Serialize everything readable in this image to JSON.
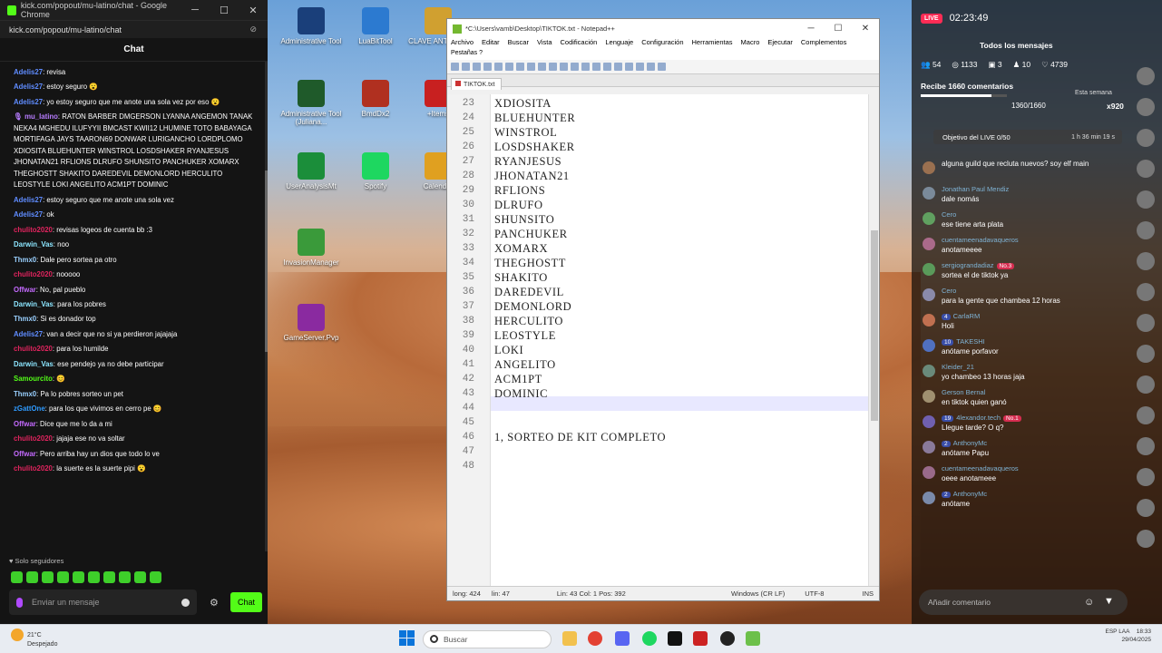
{
  "desktop": {
    "icons": [
      {
        "label": "Administrative Tool",
        "color": "#1a3f7a"
      },
      {
        "label": "LuaBitTool",
        "color": "#2c7ad0"
      },
      {
        "label": "CLAVE ANTICODI",
        "color": "#d0a030"
      },
      {
        "label": "Administrative Tool (Juliana...",
        "color": "#1f5a2a"
      },
      {
        "label": "BmdDx2",
        "color": "#b03020"
      },
      {
        "label": "+Items",
        "color": "#c82020"
      },
      {
        "label": "UserAnalysisMt",
        "color": "#1b8e3a"
      },
      {
        "label": "Spotify",
        "color": "#1ed760"
      },
      {
        "label": "Calendar",
        "color": "#e0a020"
      },
      {
        "label": "InvasionManager",
        "color": "#3a9a3a"
      },
      {
        "label": "GameServer.Pvp",
        "color": "#8a2aa0"
      }
    ]
  },
  "chat_window": {
    "title": "kick.com/popout/mu-latino/chat - Google Chrome",
    "url": "kick.com/popout/mu-latino/chat",
    "header": "Chat",
    "messages": [
      {
        "user": "",
        "text": "",
        "color": "#53fc18"
      },
      {
        "user": "Adelis27",
        "text": ": revisa",
        "color": "#5f8cff"
      },
      {
        "user": "Adelis27",
        "text": ": estoy seguro 😮",
        "color": "#5f8cff"
      },
      {
        "user": "Adelis27",
        "text": ": yo estoy seguro que me anote una sola vez por eso 😮",
        "color": "#5f8cff"
      },
      {
        "user": "🎙 mu_latino",
        "text": ": RATON BARBER DMGERSON LYANNA ANGEMON TANAK NEKA4 MGHEDU ILUFYYII BMCAST KWII12 LHUMINE TOTO BABAYAGA MORTIFAGA JAYS TAARON69 DONWAR LURIGANCHO LORDPLOMO XDIOSITA BLUEHUNTER WINSTROL LOSDSHAKER RYANJESUS JHONATAN21 RFLIONS DLRUFO SHUNSITO PANCHUKER XOMARX THEGHOSTT SHAKITO DAREDEVIL DEMONLORD HERCULITO LEOSTYLE LOKI ANGELITO ACM1PT DOMINIC",
        "color": "#b77cff"
      },
      {
        "user": "Adelis27",
        "text": ": estoy seguro que me anote una sola vez",
        "color": "#5f8cff"
      },
      {
        "user": "Adelis27",
        "text": ": ok",
        "color": "#5f8cff"
      },
      {
        "user": "chulito2020",
        "text": ": revisas logeos de cuenta bb :3",
        "color": "#e0245e"
      },
      {
        "user": "Darwin_Vas",
        "text": ": noo",
        "color": "#8ce6ff"
      },
      {
        "user": "Thmx0",
        "text": ": Dale pero sortea pa otro",
        "color": "#9ad0ff"
      },
      {
        "user": "chulito2020",
        "text": ": nooooo",
        "color": "#e0245e"
      },
      {
        "user": "Offwar",
        "text": ": No, pal pueblo",
        "color": "#c56aff"
      },
      {
        "user": "Darwin_Vas",
        "text": ": para los pobres",
        "color": "#8ce6ff"
      },
      {
        "user": "Thmx0",
        "text": ": Si es donador top",
        "color": "#9ad0ff"
      },
      {
        "user": "Adelis27",
        "text": ": van a decir que no si ya perdieron jajajaja",
        "color": "#5f8cff"
      },
      {
        "user": "chulito2020",
        "text": ": para los humilde",
        "color": "#e0245e"
      },
      {
        "user": "Darwin_Vas",
        "text": ": ese pendejo ya no debe participar",
        "color": "#8ce6ff"
      },
      {
        "user": "Samourcito",
        "text": ": 😊",
        "color": "#53fc18"
      },
      {
        "user": "Thmx0",
        "text": ": Pa lo pobres sorteo un pet",
        "color": "#9ad0ff"
      },
      {
        "user": "zGattOne",
        "text": ": para los que vivimos en cerro pe 😊",
        "color": "#2f9bff"
      },
      {
        "user": "Offwar",
        "text": ": Dice que me lo da a mi",
        "color": "#c56aff"
      },
      {
        "user": "chulito2020",
        "text": ": jajaja ese no va soltar",
        "color": "#e0245e"
      },
      {
        "user": "Offwar",
        "text": ": Pero arriba hay un dios que todo lo ve",
        "color": "#c56aff"
      },
      {
        "user": "chulito2020",
        "text": ": la suerte es la suerte pipi 😮",
        "color": "#e0245e"
      }
    ],
    "followers_only": "♥ Solo seguidores",
    "input_placeholder": "Enviar un mensaje",
    "send_label": "Chat"
  },
  "notepad": {
    "title": "*C:\\Users\\vamb\\Desktop\\TIKTOK.txt - Notepad++",
    "menu": [
      "Archivo",
      "Editar",
      "Buscar",
      "Vista",
      "Codificación",
      "Lenguaje",
      "Configuración",
      "Herramientas",
      "Macro",
      "Ejecutar",
      "Complementos"
    ],
    "menu2": "Pestañas    ?",
    "tab": "TIKTOK.txt",
    "lines": [
      {
        "n": "23",
        "t": "XDIOSITA"
      },
      {
        "n": "24",
        "t": "BLUEHUNTER"
      },
      {
        "n": "25",
        "t": "WINSTROL"
      },
      {
        "n": "26",
        "t": "LOSDSHAKER"
      },
      {
        "n": "27",
        "t": "RYANJESUS"
      },
      {
        "n": "28",
        "t": "JHONATAN21"
      },
      {
        "n": "29",
        "t": "RFLIONS"
      },
      {
        "n": "30",
        "t": "DLRUFO"
      },
      {
        "n": "31",
        "t": "SHUNSITO"
      },
      {
        "n": "32",
        "t": "PANCHUKER"
      },
      {
        "n": "33",
        "t": "XOMARX"
      },
      {
        "n": "34",
        "t": "THEGHOSTT"
      },
      {
        "n": "35",
        "t": "SHAKITO"
      },
      {
        "n": "36",
        "t": "DAREDEVIL"
      },
      {
        "n": "37",
        "t": "DEMONLORD"
      },
      {
        "n": "38",
        "t": "HERCULITO"
      },
      {
        "n": "39",
        "t": "LEOSTYLE"
      },
      {
        "n": "40",
        "t": "LOKI"
      },
      {
        "n": "41",
        "t": "ANGELITO"
      },
      {
        "n": "42",
        "t": "ACM1PT"
      },
      {
        "n": "43",
        "t": "DOMINIC"
      },
      {
        "n": "44",
        "t": ""
      },
      {
        "n": "45",
        "t": ""
      },
      {
        "n": "46",
        "t": "1, SORTEO DE KIT COMPLETO"
      },
      {
        "n": "47",
        "t": ""
      },
      {
        "n": "48",
        "t": ""
      }
    ],
    "status": {
      "length": "long: 424",
      "lines": "lin: 47",
      "pos": "Lin: 43   Col: 1   Pos: 392",
      "eol": "Windows (CR LF)",
      "enc": "UTF-8",
      "mode": "INS"
    }
  },
  "tiktok_panel": {
    "time": "02:23:49",
    "all_messages": "Todos los mensajes",
    "stats": {
      "viewers": "54",
      "coins": "1133",
      "gifts": "3",
      "users": "10",
      "likes": "4739"
    },
    "receive": "Recibe 1660 comentarios",
    "progress_value": "1360/1660",
    "progress_fraction": 0.82,
    "week_label": "Esta semana",
    "multiplier": "x920",
    "objective": "Objetivo del LIVE 0/50",
    "objective_time": "1 h 36 min 19 s",
    "messages": [
      {
        "user": "",
        "text": "alguna guild que recluta nuevos? soy elf main",
        "badge": "",
        "badge2": ""
      },
      {
        "user": "Jonathan Paul Mendiz",
        "text": "dale nomás",
        "badge": "",
        "badge2": ""
      },
      {
        "user": "Cero",
        "text": "ese tiene arta plata",
        "badge": "",
        "badge2": ""
      },
      {
        "user": "cuentameenadavaqueros",
        "text": "anotameeee",
        "badge": "",
        "badge2": ""
      },
      {
        "user": "sergiograndadiaz",
        "text": "sortea el de tiktok ya",
        "badge": "",
        "badge2": "No.3"
      },
      {
        "user": "Cero",
        "text": "para la gente que chambea 12 horas",
        "badge": "",
        "badge2": ""
      },
      {
        "user": "CarlaRM",
        "text": "Holi",
        "badge": "4",
        "badge2": ""
      },
      {
        "user": "TAKESHI",
        "text": "anótame porfavor",
        "badge": "10",
        "badge2": ""
      },
      {
        "user": "Kleider_21",
        "text": "yo chambeo 13 horas jaja",
        "badge": "",
        "badge2": ""
      },
      {
        "user": "Gerson Bernal",
        "text": "en tiktok quien ganó",
        "badge": "",
        "badge2": ""
      },
      {
        "user": "4lexandor.tech",
        "text": "Llegue tarde? O q?",
        "badge": "19",
        "badge2": "No.1"
      },
      {
        "user": "AnthonyMc",
        "text": "anótame Papu",
        "badge": "2",
        "badge2": ""
      },
      {
        "user": "cuentameenadavaqueros",
        "text": "oeee anotameee",
        "badge": "",
        "badge2": ""
      },
      {
        "user": "AnthonyMc",
        "text": "anótame",
        "badge": "2",
        "badge2": ""
      }
    ],
    "add_comment": "Añadir comentario"
  },
  "taskbar": {
    "temp": "21°C",
    "weather": "Despejado",
    "search": "Buscar",
    "lang": "ESP LAA",
    "time": "18:33",
    "date": "29/04/2025"
  }
}
